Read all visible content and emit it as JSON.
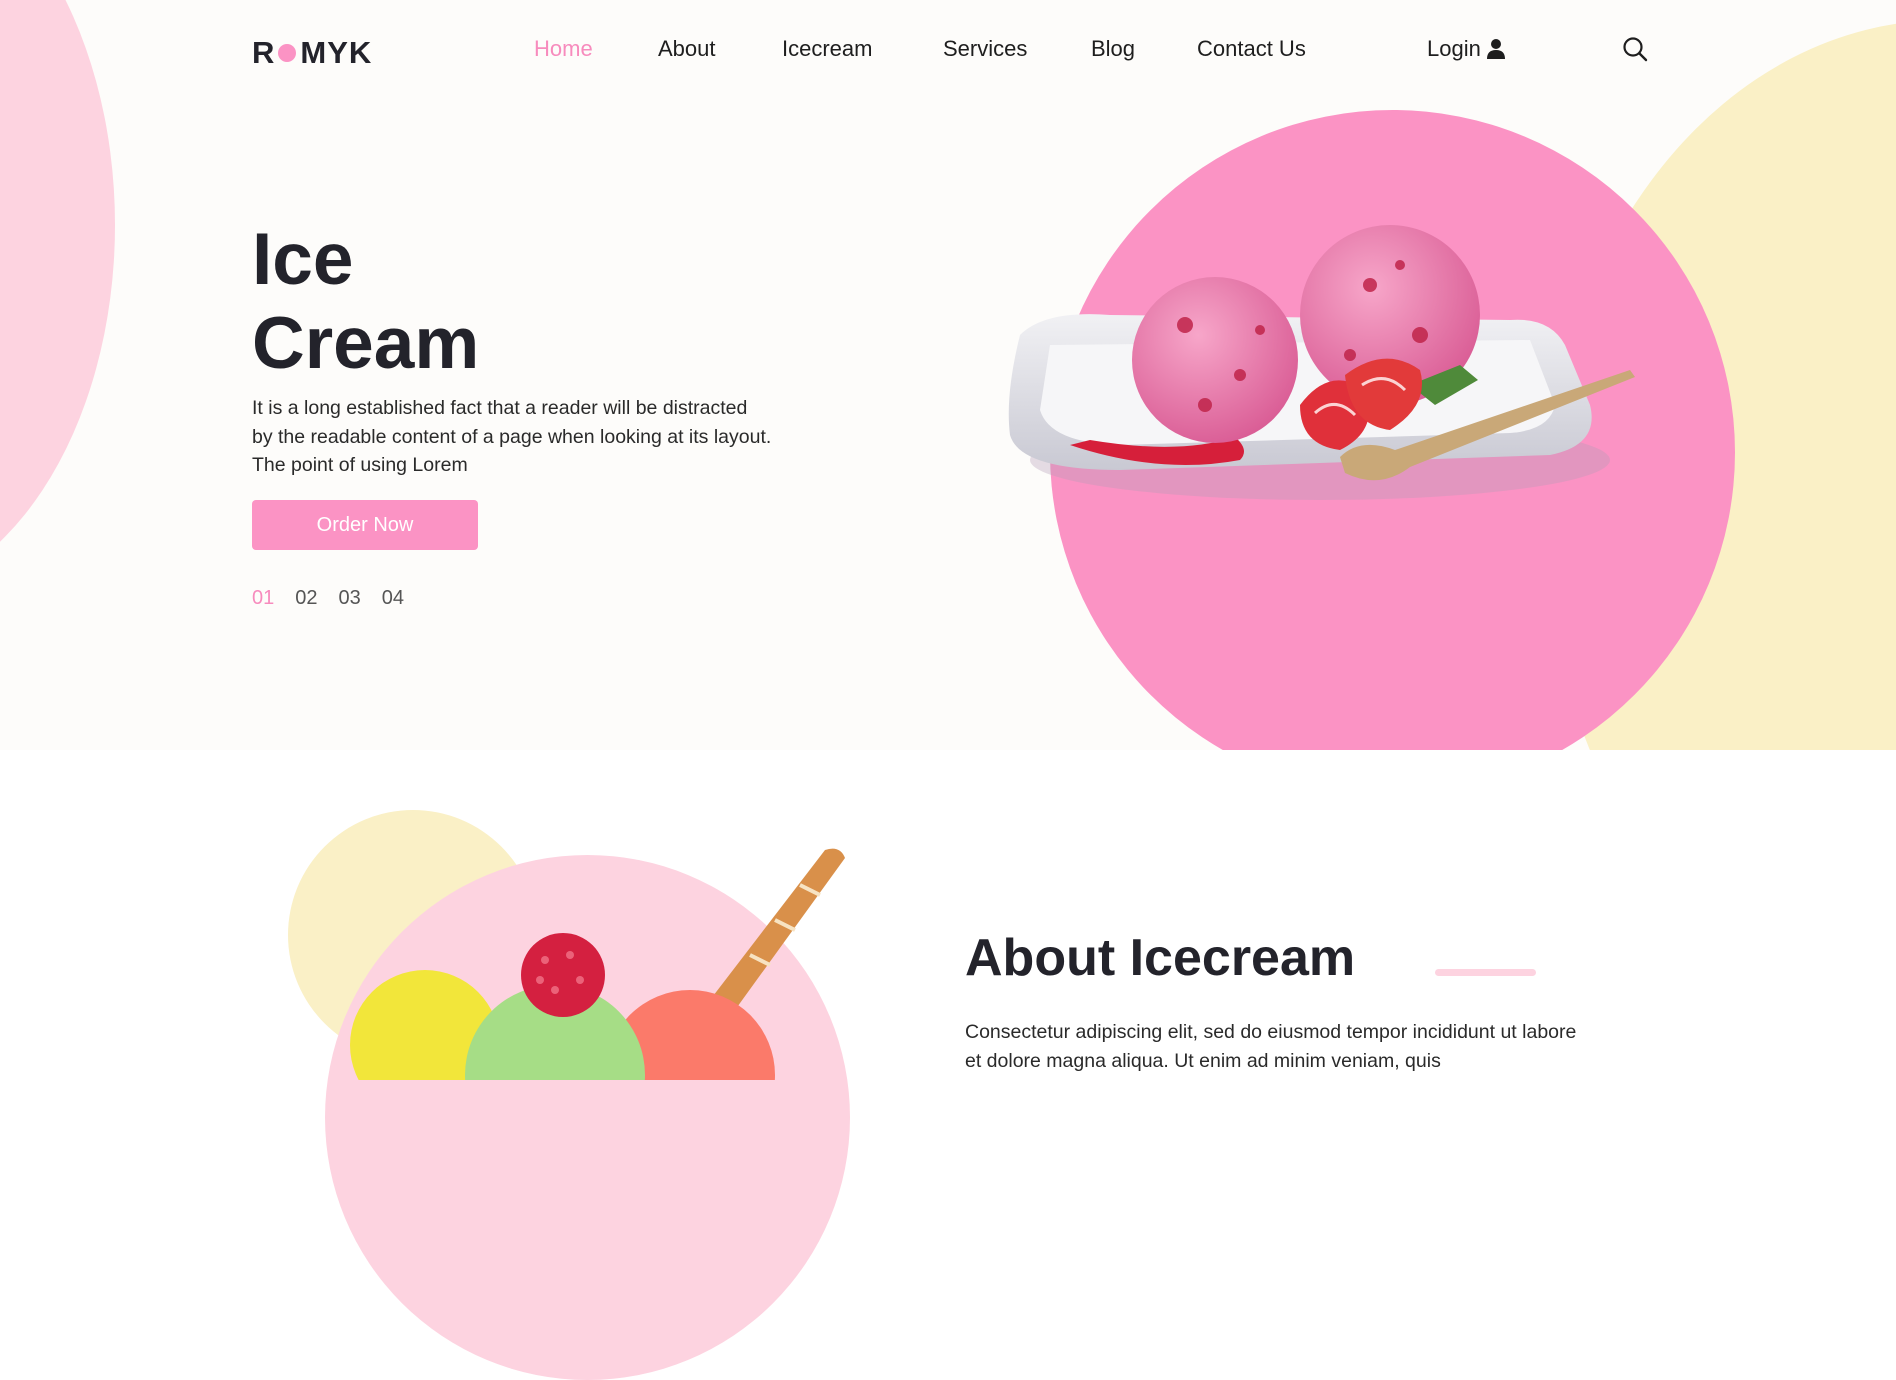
{
  "logo": {
    "left": "R",
    "right": "MYK"
  },
  "nav": {
    "items": [
      {
        "label": "Home",
        "active": true
      },
      {
        "label": "About",
        "active": false
      },
      {
        "label": "Icecream",
        "active": false
      },
      {
        "label": "Services",
        "active": false
      },
      {
        "label": "Blog",
        "active": false
      },
      {
        "label": "Contact Us",
        "active": false
      }
    ],
    "login_label": "Login"
  },
  "hero": {
    "title_line1": "Ice",
    "title_line2": "Cream",
    "description": "It is a long established fact that a reader will be distracted by the readable content of a page when looking at its layout. The point of using Lorem",
    "button_label": "Order Now",
    "pager": [
      "01",
      "02",
      "03",
      "04"
    ],
    "active_page": "01"
  },
  "about": {
    "title": "About Icecream",
    "text": "Consectetur adipiscing elit, sed do eiusmod tempor incididunt ut labore et dolore magna aliqua. Ut enim ad minim veniam, quis"
  },
  "colors": {
    "accent_pink": "#fb93c4",
    "nav_active": "#f78bbd",
    "light_pink": "#fdd3e0",
    "cream": "#faf0c6",
    "heading": "#23232b"
  },
  "icons": [
    "user-icon",
    "search-icon",
    "logo-dot"
  ]
}
